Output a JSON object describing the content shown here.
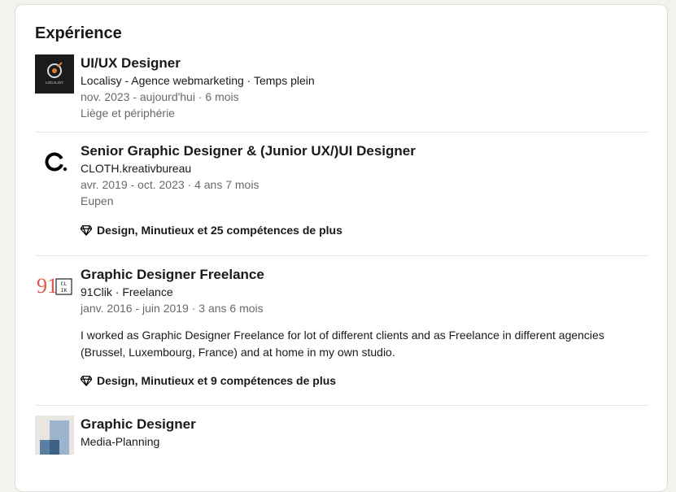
{
  "section": {
    "title": "Expérience"
  },
  "experiences": [
    {
      "role": "UI/UX Designer",
      "company": "Localisy - Agence webmarketing · Temps plein",
      "dates": "nov. 2023 - aujourd'hui · 6 mois",
      "location": "Liège et périphérie",
      "logo_text": "LOCALISY",
      "logo_icon": "localisy-logo"
    },
    {
      "role": "Senior Graphic Designer & (Junior UX/)UI Designer",
      "company": "CLOTH.kreativbureau",
      "dates": "avr. 2019 - oct. 2023 · 4 ans 7 mois",
      "location": "Eupen",
      "skills": "Design, Minutieux et 25 compétences de plus",
      "logo_icon": "cloth-logo"
    },
    {
      "role": "Graphic Designer Freelance",
      "company": "91Clik · Freelance",
      "dates": "janv. 2016 - juin 2019 · 3 ans 6 mois",
      "description": "I worked as Graphic Designer Freelance for lot of different clients and as Freelance in different agencies (Brussel, Luxembourg, France) and at home in my own studio.",
      "skills": "Design, Minutieux et 9 compétences de plus",
      "logo_text_number": "91",
      "logo_text_box": [
        "CL",
        "IK"
      ],
      "logo_icon": "91clik-logo"
    },
    {
      "role": "Graphic Designer",
      "company": "Media-Planning",
      "logo_icon": "media-planning-logo"
    }
  ],
  "colors": {
    "page_bg": "#f4f2ee",
    "card_bg": "#ffffff",
    "text_primary": "#191919",
    "text_secondary": "#666666",
    "clik_red": "#e2574c"
  }
}
